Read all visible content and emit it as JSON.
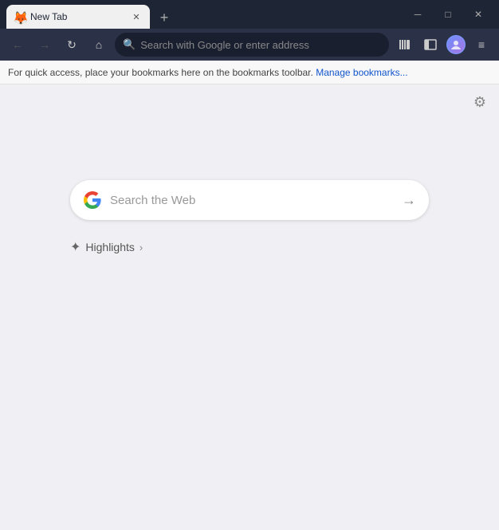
{
  "titlebar": {
    "tab": {
      "title": "New Tab",
      "favicon": "🦊"
    },
    "new_tab_btn": "+",
    "window_controls": {
      "minimize": "─",
      "maximize": "□",
      "close": "✕"
    }
  },
  "toolbar": {
    "back_btn": "←",
    "forward_btn": "→",
    "reload_btn": "↻",
    "home_btn": "⌂",
    "address_placeholder": "Search with Google or enter address",
    "library_icon": "|||",
    "sidebar_icon": "▦",
    "profile_initial": "",
    "menu_icon": "≡"
  },
  "bookmarks_bar": {
    "text": "For quick access, place your bookmarks here on the bookmarks toolbar.",
    "link_text": "Manage bookmarks..."
  },
  "main": {
    "settings_icon": "⚙",
    "search_box": {
      "placeholder": "Search the Web",
      "arrow": "→"
    },
    "highlights": {
      "icon": "✦",
      "label": "Highlights",
      "chevron": "›"
    }
  }
}
